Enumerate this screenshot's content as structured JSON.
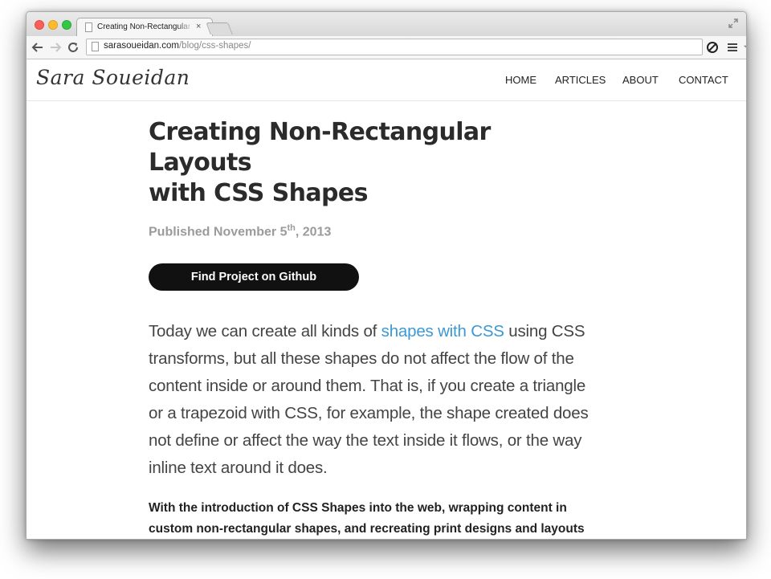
{
  "browser": {
    "tab_title": "Creating Non-Rectangular",
    "tab_close": "×",
    "url_host": "sarasoueidan.com",
    "url_path": "/blog/css-shapes/"
  },
  "site": {
    "logo": "Sara Soueidan",
    "nav": [
      "HOME",
      "ARTICLES",
      "ABOUT",
      "CONTACT"
    ]
  },
  "article": {
    "title_line1": "Creating Non-Rectangular Layouts",
    "title_line2": "with CSS Shapes",
    "published_prefix": "Published November 5",
    "published_sup": "th",
    "published_suffix": ", 2013",
    "github_button": "Find Project on Github",
    "intro_before": "Today we can create all kinds of ",
    "intro_link": "shapes with CSS",
    "intro_after": " using CSS transforms, but all these shapes do not affect the flow of the content inside or around them. That is, if you create a triangle or a trapezoid with CSS, for example, the shape created does not define or affect the way the text inside it flows, or the way inline text around it does.",
    "bold_para": "With the introduction of CSS Shapes into the web, wrapping content in custom non-rectangular shapes, and recreating print designs and layouts on the web becomes a piece of cake!"
  },
  "colors": {
    "link": "#3b99d4",
    "button_bg": "#111111",
    "muted": "#9b9b9b"
  }
}
